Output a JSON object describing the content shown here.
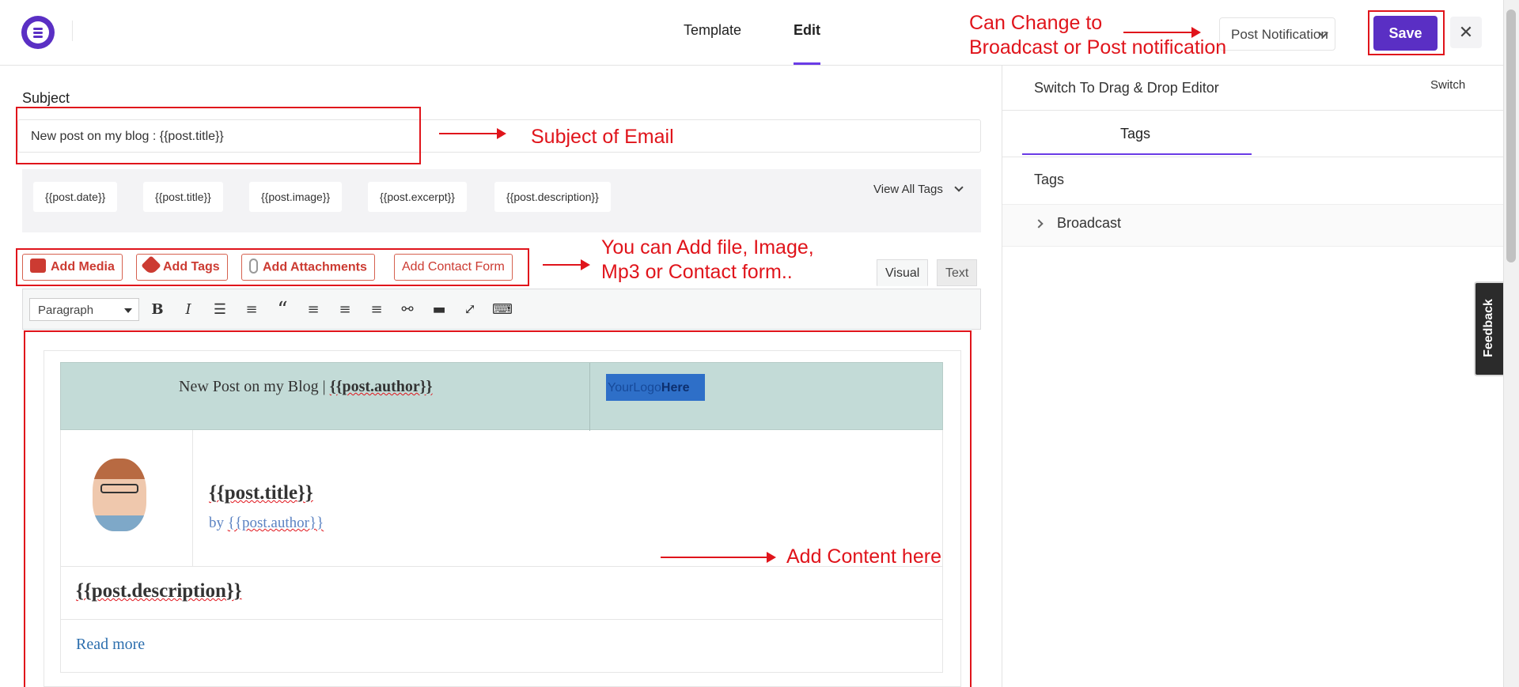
{
  "header": {
    "tabs": [
      "Template",
      "Edit"
    ],
    "active_tab": "Edit",
    "campaign_type": "Post Notification",
    "save_label": "Save",
    "close_symbol": "✕"
  },
  "editor": {
    "subject_label": "Subject",
    "subject_value": "New post on my blog : {{post.title}}",
    "tags": [
      "{{post.date}}",
      "{{post.title}}",
      "{{post.image}}",
      "{{post.excerpt}}",
      "{{post.description}}"
    ],
    "view_all_tags": "View All Tags",
    "media_buttons": {
      "add_media": "Add Media",
      "add_tags": "Add Tags",
      "add_attachments": "Add Attachments",
      "add_contact_form": "Add Contact Form"
    },
    "mode_tabs": {
      "visual": "Visual",
      "text": "Text"
    },
    "format_select": "Paragraph",
    "toolbar_icons": [
      "bold-icon",
      "italic-icon",
      "bullet-list-icon",
      "numbered-list-icon",
      "blockquote-icon",
      "align-left-icon",
      "align-center-icon",
      "align-right-icon",
      "link-icon",
      "read-more-tag-icon",
      "fullscreen-icon",
      "toolbar-toggle-icon"
    ]
  },
  "email_template": {
    "header_prefix": "New Post on my Blog | ",
    "header_author_tag": "{{post.author}}",
    "logo_text": "YourLogo",
    "logo_bold": "Here",
    "post_title": "{{post.title}}",
    "post_by": "by ",
    "post_author": "{{post.author}}",
    "post_description": "{{post.description}}",
    "read_more": "Read more"
  },
  "right_panel": {
    "title": "Switch To Drag & Drop Editor",
    "switch_label": "Switch",
    "tab_label": "Tags",
    "section_label": "Tags",
    "items": [
      "Broadcast"
    ]
  },
  "feedback_label": "Feedback",
  "annotations": {
    "type_note_line1": "Can Change to",
    "type_note_line2": "Broadcast or Post notification",
    "subject_note": "Subject of Email",
    "media_note_line1": "You can Add file, Image,",
    "media_note_line2": "Mp3 or Contact form..",
    "content_note": "Add Content here"
  },
  "colors": {
    "accent": "#5a2fc4",
    "annotation_red": "#e0141b",
    "email_header_bg": "#c3dbd7"
  }
}
